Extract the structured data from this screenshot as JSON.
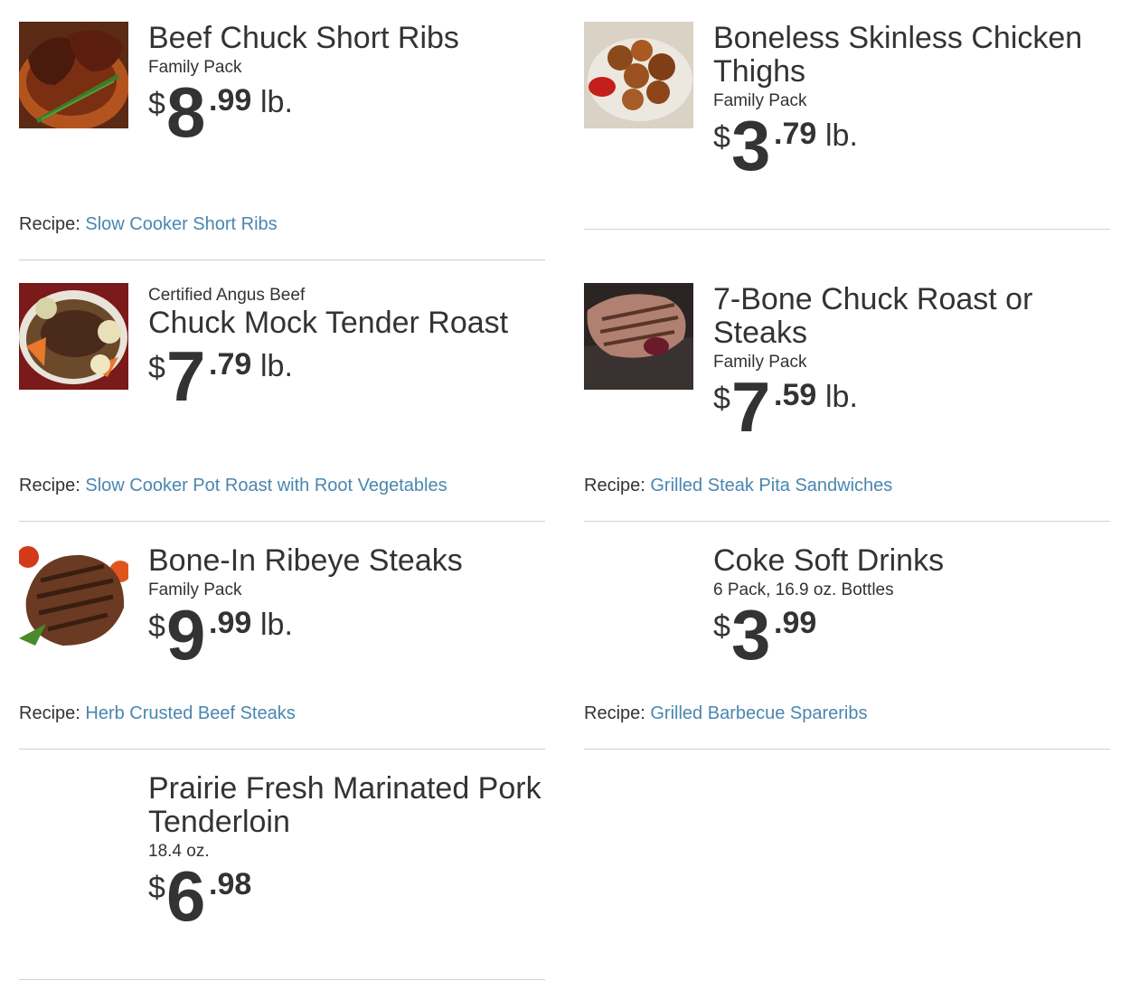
{
  "items": [
    {
      "brand": "",
      "title": "Beef Chuck Short Ribs",
      "subtitle": "Family Pack",
      "price": {
        "dollar": "$",
        "whole": "8",
        "cents": ".99",
        "unit": "lb."
      },
      "recipe_label": "Recipe:",
      "recipe_link": "Slow Cooker Short Ribs",
      "image": "short-ribs-photo"
    },
    {
      "brand": "",
      "title": "Boneless Skinless Chicken Thighs",
      "subtitle": "Family Pack",
      "price": {
        "dollar": "$",
        "whole": "3",
        "cents": ".79",
        "unit": "lb."
      },
      "recipe_label": "",
      "recipe_link": "",
      "image": "chicken-thighs-photo"
    },
    {
      "brand": "Certified Angus Beef",
      "title": "Chuck Mock Tender Roast",
      "subtitle": "",
      "price": {
        "dollar": "$",
        "whole": "7",
        "cents": ".79",
        "unit": "lb."
      },
      "recipe_label": "Recipe:",
      "recipe_link": "Slow Cooker Pot Roast with Root Vegetables",
      "image": "pot-roast-photo"
    },
    {
      "brand": "",
      "title": "7-Bone Chuck Roast or Steaks",
      "subtitle": "Family Pack",
      "price": {
        "dollar": "$",
        "whole": "7",
        "cents": ".59",
        "unit": "lb."
      },
      "recipe_label": "Recipe:",
      "recipe_link": "Grilled Steak Pita Sandwiches",
      "image": "grilled-steak-photo"
    },
    {
      "brand": "",
      "title": "Bone-In Ribeye Steaks",
      "subtitle": "Family Pack",
      "price": {
        "dollar": "$",
        "whole": "9",
        "cents": ".99",
        "unit": "lb."
      },
      "recipe_label": "Recipe:",
      "recipe_link": "Herb Crusted Beef Steaks",
      "image": "ribeye-photo"
    },
    {
      "brand": "",
      "title": "Coke Soft Drinks",
      "subtitle": "6 Pack, 16.9 oz. Bottles",
      "price": {
        "dollar": "$",
        "whole": "3",
        "cents": ".99",
        "unit": ""
      },
      "recipe_label": "Recipe:",
      "recipe_link": "Grilled Barbecue Spareribs",
      "image": ""
    },
    {
      "brand": "",
      "title": "Prairie Fresh Marinated Pork Tenderloin",
      "subtitle": "18.4 oz.",
      "price": {
        "dollar": "$",
        "whole": "6",
        "cents": ".98",
        "unit": ""
      },
      "recipe_label": "",
      "recipe_link": "",
      "image": ""
    }
  ]
}
